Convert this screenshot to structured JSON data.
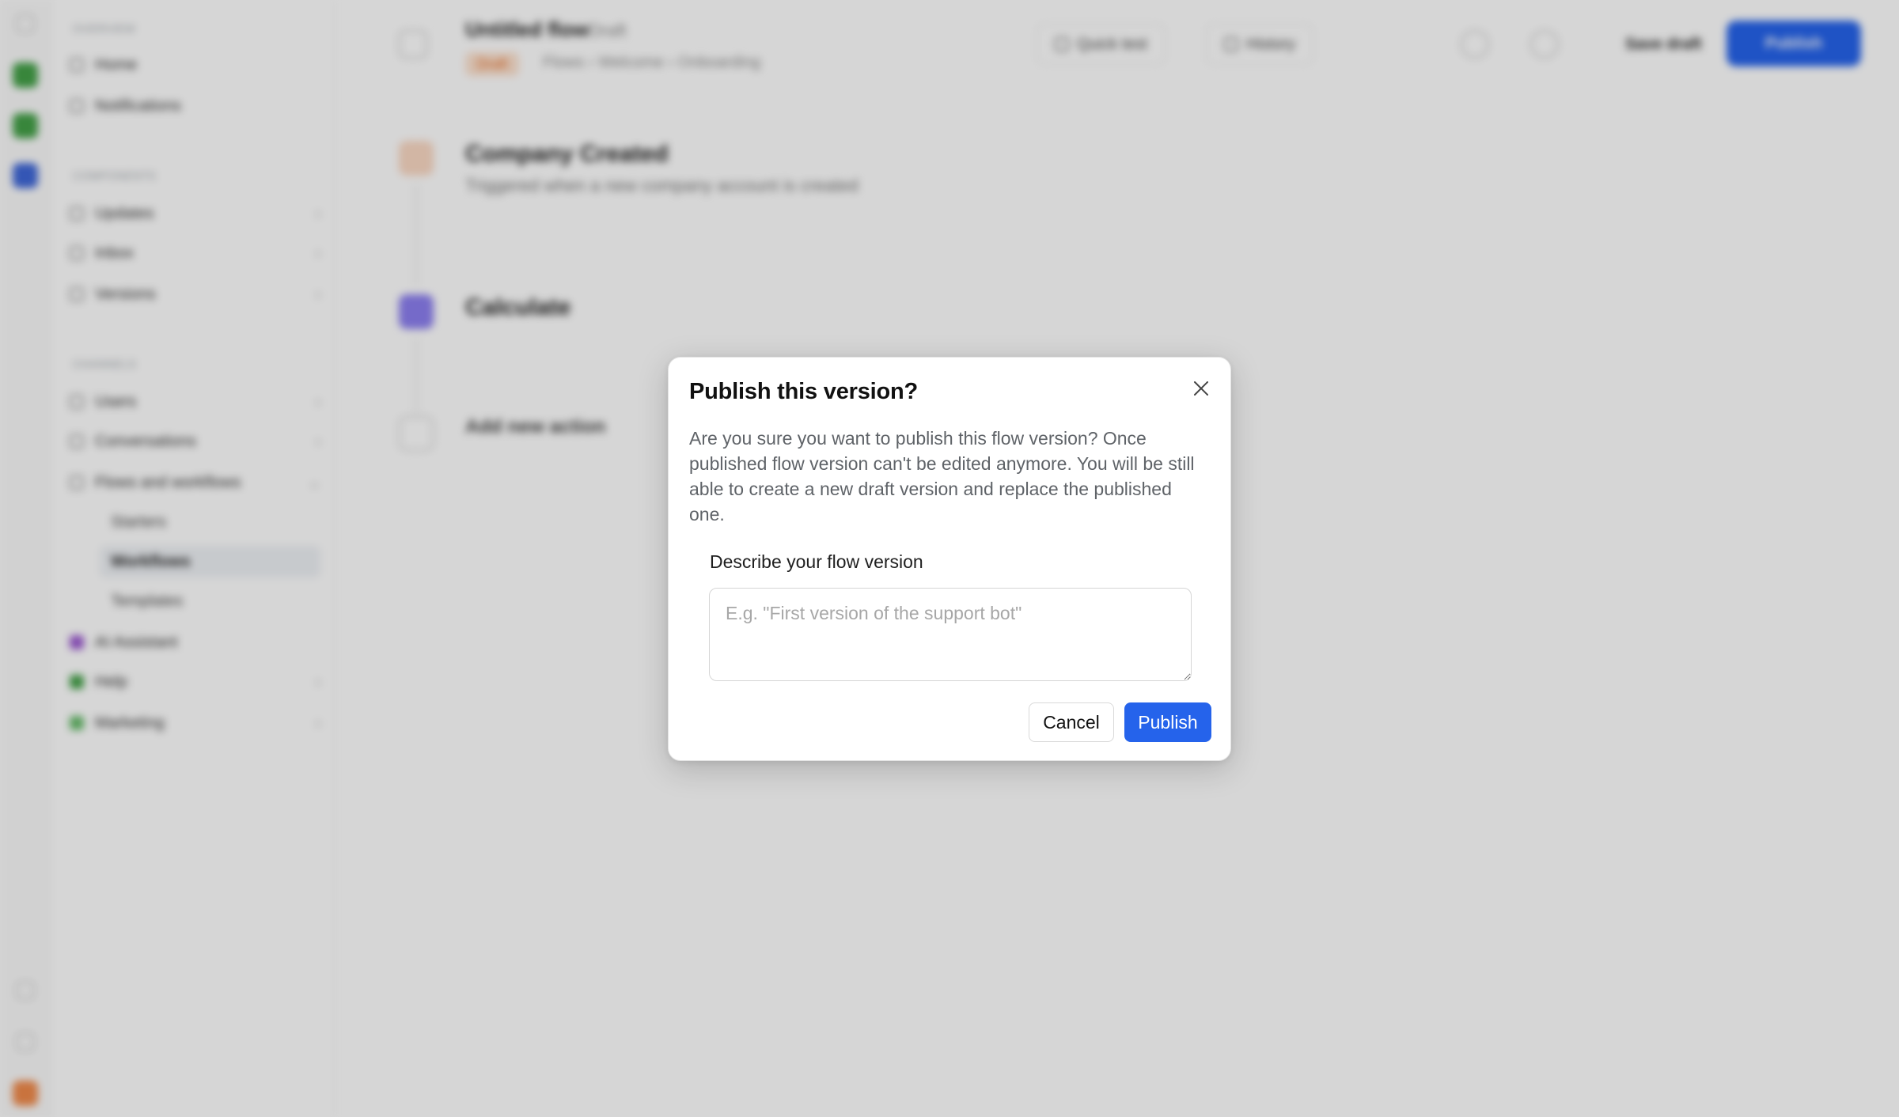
{
  "background": {
    "header": {
      "title": "Untitled flow",
      "version": "Draft",
      "status_badge": "Draft",
      "breadcrumbs": "Flows  ›  Welcome  ›  Onboarding",
      "test_label": "Quick test",
      "history_label": "History",
      "save_label": "Save draft",
      "publish_label": "Publish"
    },
    "sidebar": {
      "sections": [
        "Overview",
        "Components",
        "Channels"
      ],
      "items": [
        {
          "label": "Home"
        },
        {
          "label": "Notifications"
        },
        {
          "label": "Updates"
        },
        {
          "label": "Inbox"
        },
        {
          "label": "Versions"
        },
        {
          "label": "Users"
        },
        {
          "label": "Conversations"
        },
        {
          "label": "Flows and workflows"
        },
        {
          "label": "AI Assistant"
        },
        {
          "label": "Help"
        },
        {
          "label": "Marketing"
        }
      ],
      "sub_items": [
        "Starters",
        "Workflows",
        "Templates"
      ]
    },
    "steps": [
      {
        "title": "Company Created",
        "desc": "Triggered when a new company account is created"
      },
      {
        "title": "Calculate",
        "desc": ""
      },
      {
        "title": "Add new action",
        "desc": ""
      }
    ]
  },
  "modal": {
    "title": "Publish this version?",
    "body": "Are you sure you want to publish this flow version? Once published flow version can't be edited anymore. You will be still able to create a new draft version and replace the published one.",
    "field_label": "Describe your flow version",
    "input_placeholder": "E.g. \"First version of the support bot\"",
    "input_value": "",
    "cancel_label": "Cancel",
    "publish_label": "Publish"
  },
  "icons": {
    "close": "close-icon"
  },
  "colors": {
    "primary": "#2563eb",
    "overlay": "rgba(0,0,0,0.16)",
    "draft_badge_bg": "#fde2cf",
    "draft_badge_fg": "#e2661f"
  }
}
